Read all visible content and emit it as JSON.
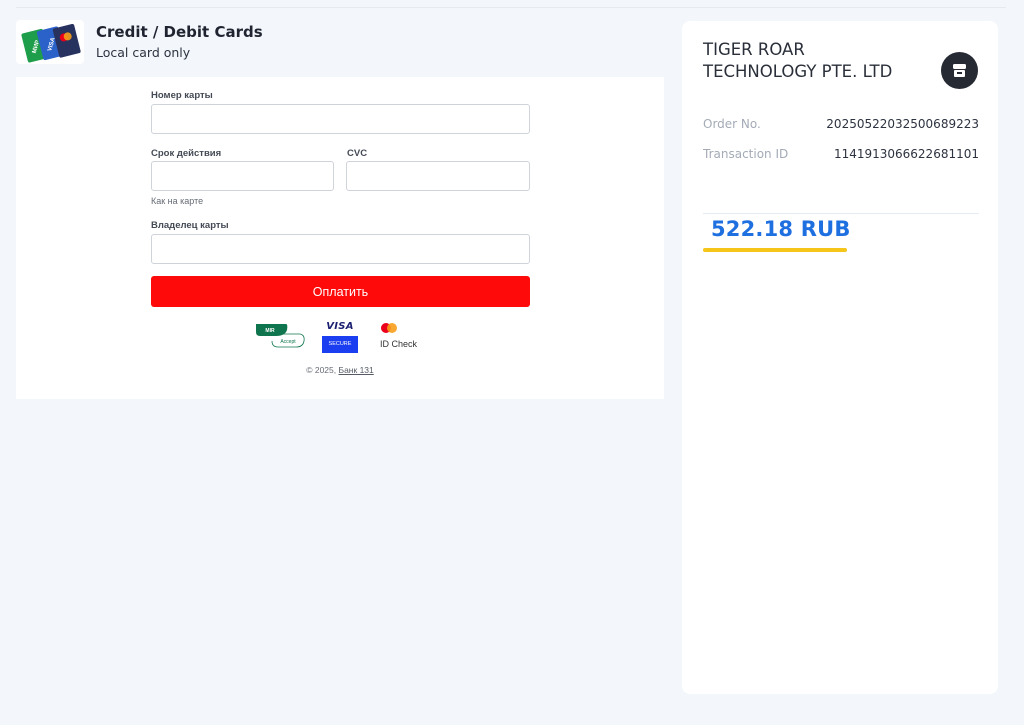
{
  "method": {
    "title": "Credit / Debit Cards",
    "subtitle": "Local card only",
    "logo_icon": "credit-cards-icon",
    "logo_card_labels": [
      "МИР",
      "VISA"
    ]
  },
  "form": {
    "card_number_label": "Номер карты",
    "card_number_value": "",
    "expiry_label": "Срок действия",
    "expiry_value": "",
    "expiry_hint": "Как на карте",
    "cvc_label": "CVC",
    "cvc_value": "",
    "holder_label": "Владелец карты",
    "holder_value": "",
    "pay_button": "Оплатить",
    "pay_button_color": "#ff0a0a"
  },
  "badges": {
    "mir_top": "MIR",
    "mir_bottom": "Accept",
    "visa_word": "VISA",
    "visa_sub": "SECURE",
    "mc_text": "ID Check"
  },
  "footer": {
    "copyright": "© 2025,",
    "bank_link": "Банк 131"
  },
  "summary": {
    "merchant": "TIGER ROAR TECHNOLOGY PTE. LTD",
    "merchant_icon": "store-icon",
    "order_label": "Order No.",
    "order_value": "20250522032500689223",
    "transaction_label": "Transaction ID",
    "transaction_value": "1141913066622681101",
    "amount": "522.18 RUB",
    "amount_color": "#1e6fe0",
    "accent_color": "#f5c51a"
  }
}
